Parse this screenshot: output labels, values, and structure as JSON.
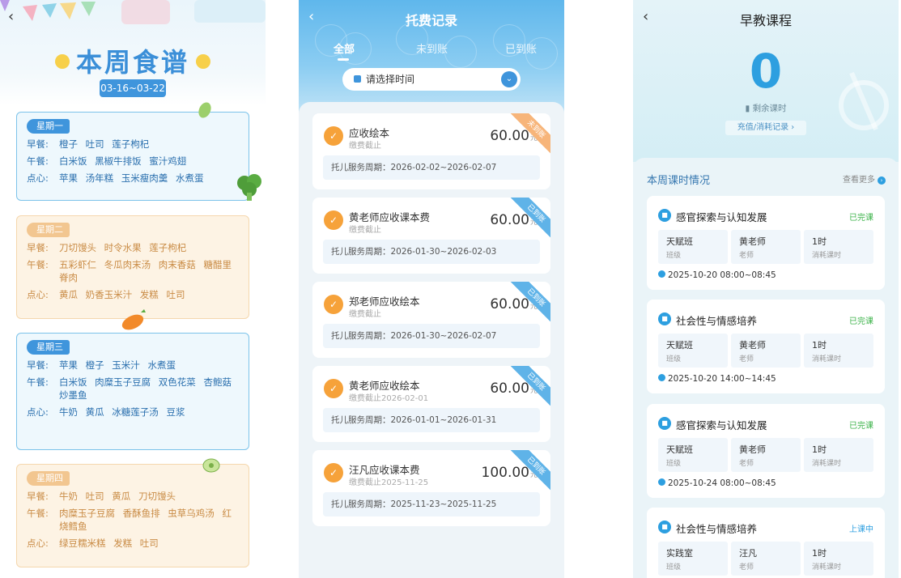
{
  "menu": {
    "back_icon": "chevron-left-icon",
    "title": "本周食谱",
    "date_range": "03-16~03-22",
    "days": [
      {
        "day": "星期一",
        "meals": [
          {
            "label": "早餐:",
            "items": "橙子 吐司 莲子枸杞"
          },
          {
            "label": "午餐:",
            "items": "白米饭 黑椒牛排饭 蜜汁鸡翅"
          },
          {
            "label": "点心:",
            "items": "苹果 汤年糕 玉米瘦肉羹 水煮蛋"
          }
        ]
      },
      {
        "day": "星期二",
        "meals": [
          {
            "label": "早餐:",
            "items": "刀切馒头 时令水果 莲子枸杞"
          },
          {
            "label": "午餐:",
            "items": "五彩虾仁 冬瓜肉末汤 肉末香菇 糖醋里脊肉"
          },
          {
            "label": "点心:",
            "items": "黄瓜 奶香玉米汁 发糕 吐司"
          }
        ]
      },
      {
        "day": "星期三",
        "meals": [
          {
            "label": "早餐:",
            "items": "苹果 橙子 玉米汁 水煮蛋"
          },
          {
            "label": "午餐:",
            "items": "白米饭 肉糜玉子豆腐 双色花菜 杏鲍菇炒墨鱼"
          },
          {
            "label": "点心:",
            "items": "牛奶 黄瓜 冰糖莲子汤 豆浆"
          }
        ]
      },
      {
        "day": "星期四",
        "meals": [
          {
            "label": "早餐:",
            "items": "牛奶 吐司 黄瓜 刀切馒头"
          },
          {
            "label": "午餐:",
            "items": "肉糜玉子豆腐 香酥鱼排 虫草乌鸡汤 红烧鳕鱼"
          },
          {
            "label": "点心:",
            "items": "绿豆糯米糕 发糕 吐司"
          }
        ]
      }
    ]
  },
  "fees": {
    "title": "托费记录",
    "tabs": [
      {
        "label": "全部"
      },
      {
        "label": "未到账"
      },
      {
        "label": "已到账"
      }
    ],
    "date_placeholder": "请选择时间",
    "records": [
      {
        "name": "应收绘本",
        "sub": "缴费截止",
        "amount": "60.00",
        "unit": "元",
        "period": "托儿服务周期：2026-02-02~2026-02-07",
        "status": "未到账"
      },
      {
        "name": "黄老师应收课本费",
        "sub": "缴费截止",
        "amount": "60.00",
        "unit": "元",
        "period": "托儿服务周期：2026-01-30~2026-02-03",
        "status": "已到账"
      },
      {
        "name": "郑老师应收绘本",
        "sub": "缴费截止",
        "amount": "60.00",
        "unit": "元",
        "period": "托儿服务周期：2026-01-30~2026-02-07",
        "status": "已到账"
      },
      {
        "name": "黄老师应收绘本",
        "sub": "缴费截止2026-02-01",
        "amount": "60.00",
        "unit": "元",
        "period": "托儿服务周期：2026-01-01~2026-01-31",
        "status": "已到账"
      },
      {
        "name": "汪凡应收课本费",
        "sub": "缴费截止2025-11-25",
        "amount": "100.00",
        "unit": "元",
        "period": "托儿服务周期：2025-11-23~2025-11-25",
        "status": "已到账"
      }
    ]
  },
  "courses": {
    "title": "早教课程",
    "remaining_count": "0",
    "remaining_label": "剩余课时",
    "recharge_label": "充值/消耗记录",
    "week_title": "本周课时情况",
    "more_label": "查看更多",
    "items": [
      {
        "name": "感官探索与认知发展",
        "status": "已完课",
        "class": "天赋班",
        "class_label": "班级",
        "teacher": "黄老师",
        "teacher_label": "老师",
        "hours": "1时",
        "hours_label": "消耗课时",
        "time": "2025-10-20 08:00~08:45"
      },
      {
        "name": "社会性与情感培养",
        "status": "已完课",
        "class": "天赋班",
        "class_label": "班级",
        "teacher": "黄老师",
        "teacher_label": "老师",
        "hours": "1时",
        "hours_label": "消耗课时",
        "time": "2025-10-20 14:00~14:45"
      },
      {
        "name": "感官探索与认知发展",
        "status": "已完课",
        "class": "天赋班",
        "class_label": "班级",
        "teacher": "黄老师",
        "teacher_label": "老师",
        "hours": "1时",
        "hours_label": "消耗课时",
        "time": "2025-10-24 08:00~08:45"
      },
      {
        "name": "社会性与情感培养",
        "status": "上课中",
        "class": "实践室",
        "class_label": "班级",
        "teacher": "汪凡",
        "teacher_label": "老师",
        "hours": "1时",
        "hours_label": "消耗课时",
        "time": ""
      }
    ]
  },
  "colors": {
    "primary_blue": "#3f95dc",
    "peach": "#f2c690",
    "done_green": "#3cb34a",
    "fee_orange": "#f6a23a"
  }
}
